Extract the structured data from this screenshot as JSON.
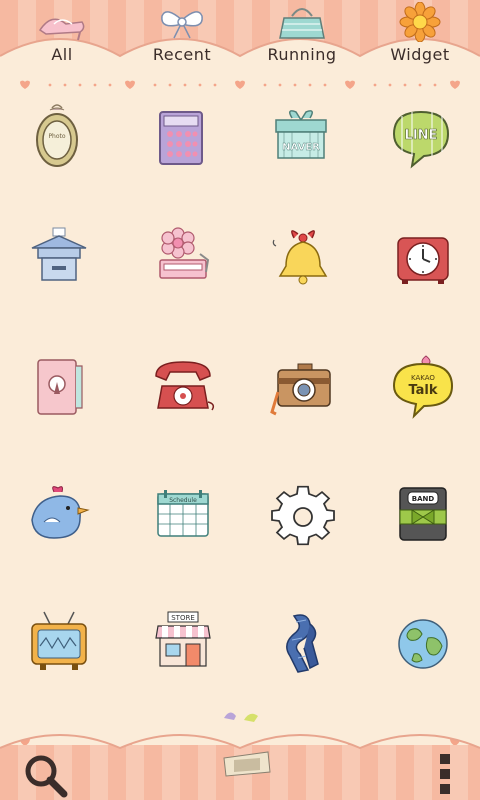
{
  "tabs": [
    {
      "label": "All",
      "icon": "high-heel-shoe-icon"
    },
    {
      "label": "Recent",
      "icon": "bow-ribbon-icon"
    },
    {
      "label": "Running",
      "icon": "handbag-icon"
    },
    {
      "label": "Widget",
      "icon": "sunflower-icon"
    }
  ],
  "apps": [
    {
      "icon": "photo-frame-icon",
      "label": "Photo"
    },
    {
      "icon": "calculator-icon"
    },
    {
      "icon": "naver-gift-box-icon",
      "label": "NAVER"
    },
    {
      "icon": "line-speech-bubble-icon",
      "label": "LINE"
    },
    {
      "icon": "mailbox-icon"
    },
    {
      "icon": "flower-gramophone-icon"
    },
    {
      "icon": "bell-icon"
    },
    {
      "icon": "alarm-clock-icon"
    },
    {
      "icon": "notebook-lock-icon"
    },
    {
      "icon": "rotary-phone-icon"
    },
    {
      "icon": "camera-icon"
    },
    {
      "icon": "kakao-talk-bubble-icon",
      "label_top": "KAKAO",
      "label": "Talk"
    },
    {
      "icon": "bluebird-icon"
    },
    {
      "icon": "schedule-calendar-icon",
      "label": "Schedule"
    },
    {
      "icon": "gear-settings-icon"
    },
    {
      "icon": "band-app-icon",
      "label": "BAND"
    },
    {
      "icon": "retro-tv-icon"
    },
    {
      "icon": "store-shop-icon",
      "label": "STORE"
    },
    {
      "icon": "blue-ribbon-icon"
    },
    {
      "icon": "globe-icon"
    }
  ],
  "bottom": {
    "search": "search-icon",
    "drawer": "drawer-handle-icon",
    "menu": "overflow-menu-icon"
  },
  "colors": {
    "background": "#fbecd9",
    "awning_stripe_a": "#f6b9a1",
    "awning_stripe_b": "#f8c9b4",
    "heart": "#f4a58a"
  }
}
